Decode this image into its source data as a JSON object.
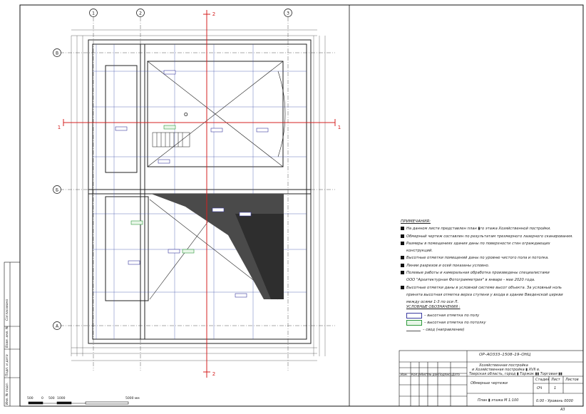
{
  "sheet": {
    "section_marks": {
      "top": "2",
      "bottom": "2",
      "left": "1",
      "right": "1"
    },
    "axes": {
      "columns": [
        "1",
        "2",
        "3"
      ],
      "rows": [
        "В",
        "Б",
        "А"
      ]
    },
    "room_label": "О",
    "scale_bar": {
      "labels": [
        "500",
        "0",
        "500",
        "1000",
        "5000 мм"
      ]
    }
  },
  "notes": {
    "title": "ПРИМЕЧАНИЯ:",
    "items": [
      "На данном листе представлен план ▮го этажа Хозяйственной постройки.",
      "Обмерный чертеж составлен по результатам трехмерного лазерного сканирования.",
      "Размеры в помещениях здания даны по поверхности стен ограждающих",
      "конструкций.",
      "Высотные отметки помещений даны по уровню чистого пола и потолка.",
      "Линии разрезов и осей показаны условно.",
      "Полевые работы и камеральная обработка произведены специалистами",
      "ООО \"Архитектурная Фотограмметрия\" в январе - мае 2020 года.",
      "Высотные отметки даны в условной системе высот объекта. За условный ноль",
      "принята высотная отметка верха ступени у входа в здание Введенской церкви",
      "между осями 1-3 по оси Л."
    ]
  },
  "legend": {
    "title": "УСЛОВНЫЕ ОБОЗНАЧЕНИЯ :",
    "items": [
      {
        "text": "– высотная отметка по полу",
        "color": "#3a3aa0"
      },
      {
        "text": "– высотная отметка по потолку",
        "color": "#2e9a3c"
      },
      {
        "text": "– свод (направление)",
        "color": "#555555"
      }
    ]
  },
  "title_block": {
    "code": "ОР–АО333–1508–19–ОНЦ",
    "address_1": "Хозяйственная постройка",
    "address_2": "и Хозяйственная постройка ▮ XVII в.",
    "address_3": "Тверская область, город ▮ Торжок ▮▮ Торговая ▮▮",
    "sheet_title": "Обмерные чертежи",
    "stage_hdr": "Стадия",
    "sheet_hdr": "Лист",
    "sheets_hdr": "Листов",
    "stage": "ОЧ",
    "sheet_no": "1",
    "plan_name": "План ▮ этажа М 1:100",
    "level": "0.00 - Уровень 0000",
    "format": "А3",
    "side_labels": [
      "Согласовано",
      "Взам. инв. №",
      "Подп. и дата",
      "Инв. № подл."
    ],
    "cols": [
      "Изм.",
      "Кол.уч",
      "Лист",
      "№ док.",
      "Подпись",
      "Дата"
    ]
  }
}
